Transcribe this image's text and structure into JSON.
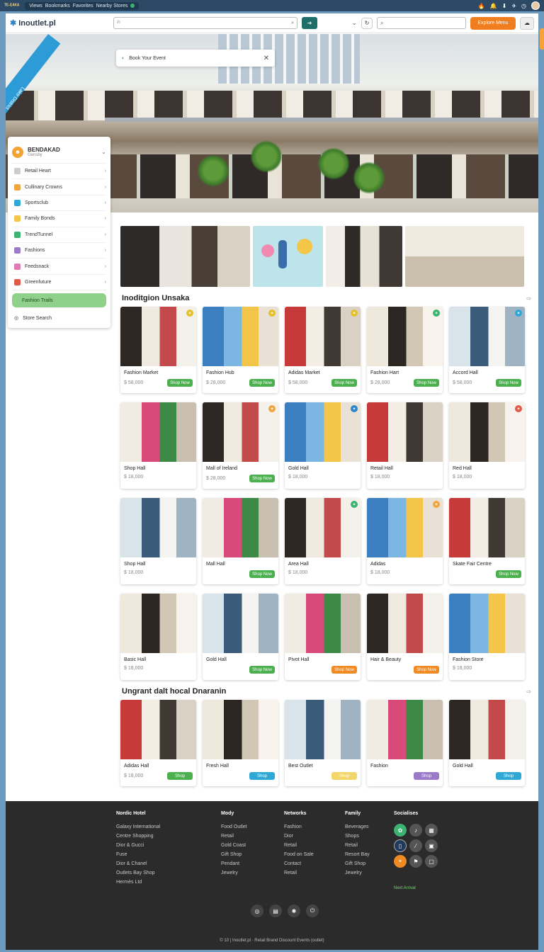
{
  "os": {
    "app": "ᵀᴱ·ᴱᴬᴷᴬ",
    "menu": [
      "Views",
      "Bookmarks",
      "Favorites",
      "Nearby Stores"
    ],
    "icons": [
      "fire-icon",
      "notification-icon",
      "download-icon",
      "send-icon",
      "timer-icon",
      "user-avatar"
    ]
  },
  "nav": {
    "logo": "Inoutlet.pl",
    "search_placeholder": "ᴶ⁵ ",
    "search2_placeholder": "",
    "cta": "Explore Menu"
  },
  "hero": {
    "banner": "Lake District",
    "alert": "Book Your Event"
  },
  "sidebar": {
    "title": "BENDAKAD",
    "subtitle": "Gensby",
    "items": [
      {
        "label": "Retail Heart",
        "color": "#cccccc"
      },
      {
        "label": "Cullinary Crowns",
        "color": "#f0a640"
      },
      {
        "label": "Sportsclub",
        "color": "#2fa8d6"
      },
      {
        "label": "Family Bonds",
        "color": "#f3c64a"
      },
      {
        "label": "TrendTunnel",
        "color": "#3cb371"
      },
      {
        "label": "Fashions",
        "color": "#9a7ac9"
      },
      {
        "label": "Feedsnack",
        "color": "#e07ab0"
      },
      {
        "label": "Greenfuture",
        "color": "#e05a4a"
      }
    ],
    "active": "Fashion Trails",
    "footer": "Store Search"
  },
  "sections": [
    {
      "title": "Inoditgion Unsaka",
      "cards": [
        {
          "name": "Fashion Market",
          "price": "$ 58,000",
          "button": "Shop Now",
          "btn_color": "#4cb04f",
          "badge_color": "#e4c12c"
        },
        {
          "name": "Fashion Hub",
          "price": "$ 28,000",
          "button": "Shop Now",
          "btn_color": "#4cb04f",
          "badge_color": "#e4c12c"
        },
        {
          "name": "Adidas Market",
          "price": "$ 58,000",
          "button": "Shop Now",
          "btn_color": "#4cb04f",
          "badge_color": "#e4c12c"
        },
        {
          "name": "Fashion Hart",
          "price": "$ 28,000",
          "button": "Shop Now",
          "btn_color": "#4cb04f",
          "badge_color": "#3cb371"
        },
        {
          "name": "Accord Hall",
          "price": "$ 58,000",
          "button": "Shop Now",
          "btn_color": "#4cb04f",
          "badge_color": "#2fa8d6"
        },
        {
          "name": "Shop Hall",
          "price": "$ 18,000",
          "button": "",
          "btn_color": "",
          "badge_color": ""
        },
        {
          "name": "Mall of Ireland",
          "price": "$ 28,000",
          "button": "Shop Now",
          "btn_color": "#4cb04f",
          "badge_color": "#f0a640"
        },
        {
          "name": "Gold Hall",
          "price": "$ 18,000",
          "button": "",
          "btn_color": "",
          "badge_color": "#2d84c9"
        },
        {
          "name": "Retail Hall",
          "price": "$ 18,000",
          "button": "",
          "btn_color": "",
          "badge_color": ""
        },
        {
          "name": "Red Hall",
          "price": "$ 18,000",
          "button": "",
          "btn_color": "",
          "badge_color": "#e05a4a"
        },
        {
          "name": "Shop Hall",
          "price": "$ 18,000",
          "button": "",
          "btn_color": "",
          "badge_color": ""
        },
        {
          "name": "Mall Hall",
          "price": "",
          "button": "Shop Now",
          "btn_color": "#4cb04f",
          "badge_color": ""
        },
        {
          "name": "Area Hall",
          "price": "$ 18,000",
          "button": "",
          "btn_color": "",
          "badge_color": "#3cb371"
        },
        {
          "name": "Adidas",
          "price": "$ 18,000",
          "button": "",
          "btn_color": "",
          "badge_color": "#f0a640"
        },
        {
          "name": "Skate Fair Centre",
          "price": "",
          "button": "Shop Now",
          "btn_color": "#4cb04f",
          "badge_color": ""
        },
        {
          "name": "Basic Hall",
          "price": "$ 18,000",
          "button": "",
          "btn_color": "",
          "badge_color": ""
        },
        {
          "name": "Gold Hall",
          "price": "",
          "button": "Shop Now",
          "btn_color": "#4cb04f",
          "badge_color": ""
        },
        {
          "name": "Pivot Hall",
          "price": "",
          "button": "Shop Now",
          "btn_color": "#f08a24",
          "badge_color": ""
        },
        {
          "name": "Hair & Beauty",
          "price": "",
          "button": "Shop Now",
          "btn_color": "#f08a24",
          "badge_color": ""
        },
        {
          "name": "Fashion Store",
          "price": "$ 18,000",
          "button": "",
          "btn_color": "",
          "badge_color": ""
        }
      ]
    },
    {
      "title": "Ungrant dalt hocal Dnaranin",
      "cards": [
        {
          "name": "Adidas Hall",
          "price": "$ 18,000",
          "button": "Shop",
          "btn_color": "#4cb04f",
          "badge_color": ""
        },
        {
          "name": "Fresh Hall",
          "price": "",
          "button": "Shop",
          "btn_color": "#2fa8d6",
          "badge_color": ""
        },
        {
          "name": "Best Outlet",
          "price": "",
          "button": "Shop",
          "btn_color": "#f3d66a",
          "badge_color": ""
        },
        {
          "name": "Fashion",
          "price": "",
          "button": "Shop",
          "btn_color": "#9a7ac9",
          "badge_color": ""
        },
        {
          "name": "Gold Hall",
          "price": "",
          "button": "Shop",
          "btn_color": "#2fa8d6",
          "badge_color": ""
        }
      ]
    }
  ],
  "footer": {
    "columns": [
      {
        "heading": "Nordic Hotel",
        "links": [
          "Galaxy International",
          "Centre Shopping",
          "Dior & Gucci",
          "Fuse",
          "Dior & Chanel",
          "Outlets Bay Shop",
          "Hermès Ltd"
        ]
      },
      {
        "heading": "Mody",
        "links": [
          "Food Outlet",
          "Retail",
          "Gold Coast",
          "Gift Shop",
          "Pendant",
          "Jewelry"
        ]
      },
      {
        "heading": "Networks",
        "links": [
          "Fashion",
          "Dior",
          "Retail",
          "Food on Sale",
          "Contact",
          "Retail"
        ]
      },
      {
        "heading": "Family",
        "links": [
          "Beverages",
          "Shops",
          "Retail",
          "Resort Bay",
          "Gift Shop",
          "Jewelry"
        ]
      }
    ],
    "social_heading": "Socialises",
    "social_note": "Next Arrival",
    "copyright": "© 10 | Inoutlet.pl · Retail Brand Discount Events (outlet)"
  }
}
